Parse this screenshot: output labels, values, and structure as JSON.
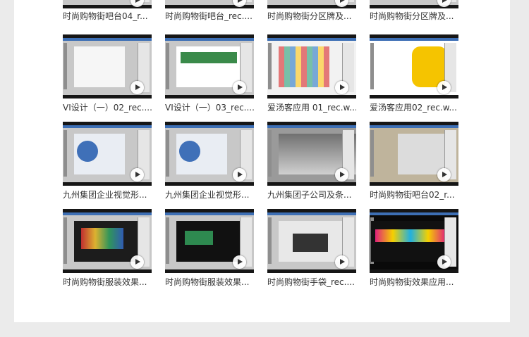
{
  "rows": [
    {
      "tiles": [
        {
          "caption": "时尚购物街吧台04_r...",
          "icon": "play-icon",
          "style": "t-ws"
        },
        {
          "caption": "时尚购物街吧台_rec....",
          "icon": "play-icon",
          "style": "t-ws"
        },
        {
          "caption": "时尚购物街分区牌及...",
          "icon": "play-icon",
          "style": "t-ws"
        },
        {
          "caption": "时尚购物街分区牌及...",
          "icon": "play-icon",
          "style": "t-ws"
        }
      ]
    },
    {
      "tiles": [
        {
          "caption": "VI设计（一）02_rec....",
          "icon": "play-icon",
          "style": "t-ws"
        },
        {
          "caption": "VI设计（一）03_rec....",
          "icon": "play-icon",
          "style": "t-green"
        },
        {
          "caption": "爱汤客应用 01_rec.w...",
          "icon": "play-icon",
          "style": "t-grid"
        },
        {
          "caption": "爱汤客应用02_rec.w...",
          "icon": "play-icon",
          "style": "t-brand"
        }
      ]
    },
    {
      "tiles": [
        {
          "caption": "九州集团企业视觉形...",
          "icon": "play-icon",
          "style": "t-blue"
        },
        {
          "caption": "九州集团企业视觉形...",
          "icon": "play-icon",
          "style": "t-blue"
        },
        {
          "caption": "九州集团子公司及条...",
          "icon": "play-icon",
          "style": "t-hall"
        },
        {
          "caption": "时尚购物街吧台02_r...",
          "icon": "play-icon",
          "style": "t-beige"
        }
      ]
    },
    {
      "tiles": [
        {
          "caption": "时尚购物街服装效果...",
          "icon": "play-icon",
          "style": "t-dark"
        },
        {
          "caption": "时尚购物街服装效果...",
          "icon": "play-icon",
          "style": "t-black"
        },
        {
          "caption": "时尚购物街手袋_rec....",
          "icon": "play-icon",
          "style": "t-gray"
        },
        {
          "caption": "时尚购物街效果应用...",
          "icon": "play-icon",
          "style": "t-neon"
        }
      ]
    }
  ]
}
